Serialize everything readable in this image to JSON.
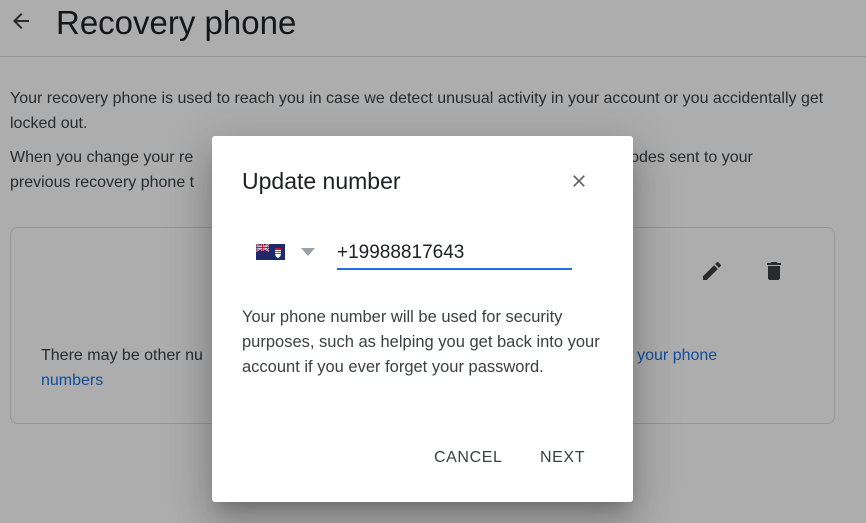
{
  "header": {
    "title": "Recovery phone",
    "back_icon": "arrow-back-icon"
  },
  "content": {
    "paragraph1": "Your recovery phone is used to reach you in case we detect unusual activity in your account or you accidentally get locked out.",
    "paragraph2_start": "When you change your re",
    "paragraph2_tail": "in codes sent to your",
    "paragraph2_line2": "previous recovery phone t"
  },
  "card": {
    "note_start": "There may be other nu",
    "link_tail": "ge your phone",
    "link_line2": "numbers",
    "edit_icon": "pencil-icon",
    "delete_icon": "trash-icon"
  },
  "dialog": {
    "title": "Update number",
    "close_icon": "close-icon",
    "country_flag": "cayman-islands-flag-icon",
    "phone_value": "+19988817643",
    "body": "Your phone number will be used for security purposes, such as helping you get back into your account if you ever forget your password.",
    "cancel_label": "CANCEL",
    "next_label": "NEXT"
  },
  "colors": {
    "accent": "#1a73e8",
    "scrim": "rgba(0,0,0,0.32)",
    "text_primary": "#202124",
    "text_secondary": "#3c4043"
  }
}
